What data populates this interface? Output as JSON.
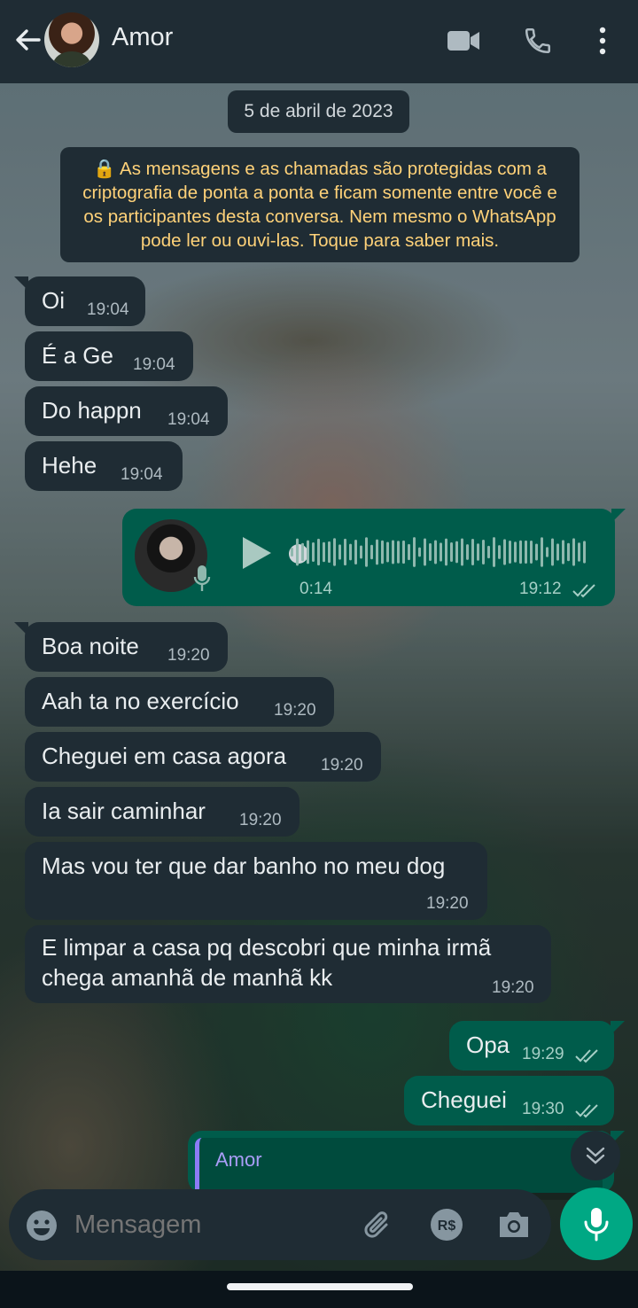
{
  "header": {
    "title": "Amor",
    "icons": [
      "back-arrow-icon",
      "video-call-icon",
      "voice-call-icon",
      "more-options-icon"
    ]
  },
  "chat": {
    "date_chip": "5 de abril de 2023",
    "encryption_notice": "🔒 As mensagens e as chamadas são protegidas com a criptografia de ponta a ponta e ficam somente entre você e os participantes desta conversa. Nem mesmo o WhatsApp pode ler ou ouvi-las. Toque para saber mais.",
    "messages": [
      {
        "dir": "in",
        "text": "Oi",
        "time": "19:04"
      },
      {
        "dir": "in",
        "text": "É a Ge",
        "time": "19:04"
      },
      {
        "dir": "in",
        "text": "Do happn",
        "time": "19:04"
      },
      {
        "dir": "in",
        "text": "Hehe",
        "time": "19:04"
      },
      {
        "dir": "out",
        "type": "audio",
        "duration": "0:14",
        "time": "19:12",
        "status": "read"
      },
      {
        "dir": "in",
        "text": "Boa noite",
        "time": "19:20"
      },
      {
        "dir": "in",
        "text": "Aah ta no exercício",
        "time": "19:20"
      },
      {
        "dir": "in",
        "text": "Cheguei em casa agora",
        "time": "19:20"
      },
      {
        "dir": "in",
        "text": "Ia sair caminhar",
        "time": "19:20"
      },
      {
        "dir": "in",
        "text": "Mas vou ter que dar banho no meu dog",
        "time": "19:20"
      },
      {
        "dir": "in",
        "text_line1": "E limpar a casa pq descobri que minha irmã",
        "text_line2": "chega amanhã de manhã kk",
        "time": "19:20"
      },
      {
        "dir": "out",
        "text": "Opa",
        "time": "19:29",
        "status": "read"
      },
      {
        "dir": "out",
        "text": "Cheguei",
        "time": "19:30",
        "status": "read"
      },
      {
        "dir": "out",
        "type": "reply",
        "quoted_author": "Amor"
      }
    ]
  },
  "input": {
    "placeholder": "Mensagem",
    "icons": [
      "emoji-icon",
      "attach-icon",
      "payment-icon",
      "camera-icon",
      "mic-icon"
    ]
  },
  "colors": {
    "header_bg": "#1f2c34",
    "incoming_bubble": "#1f2c34",
    "outgoing_bubble": "#005c4b",
    "accent": "#00a884",
    "notice_text": "#ffd279"
  }
}
